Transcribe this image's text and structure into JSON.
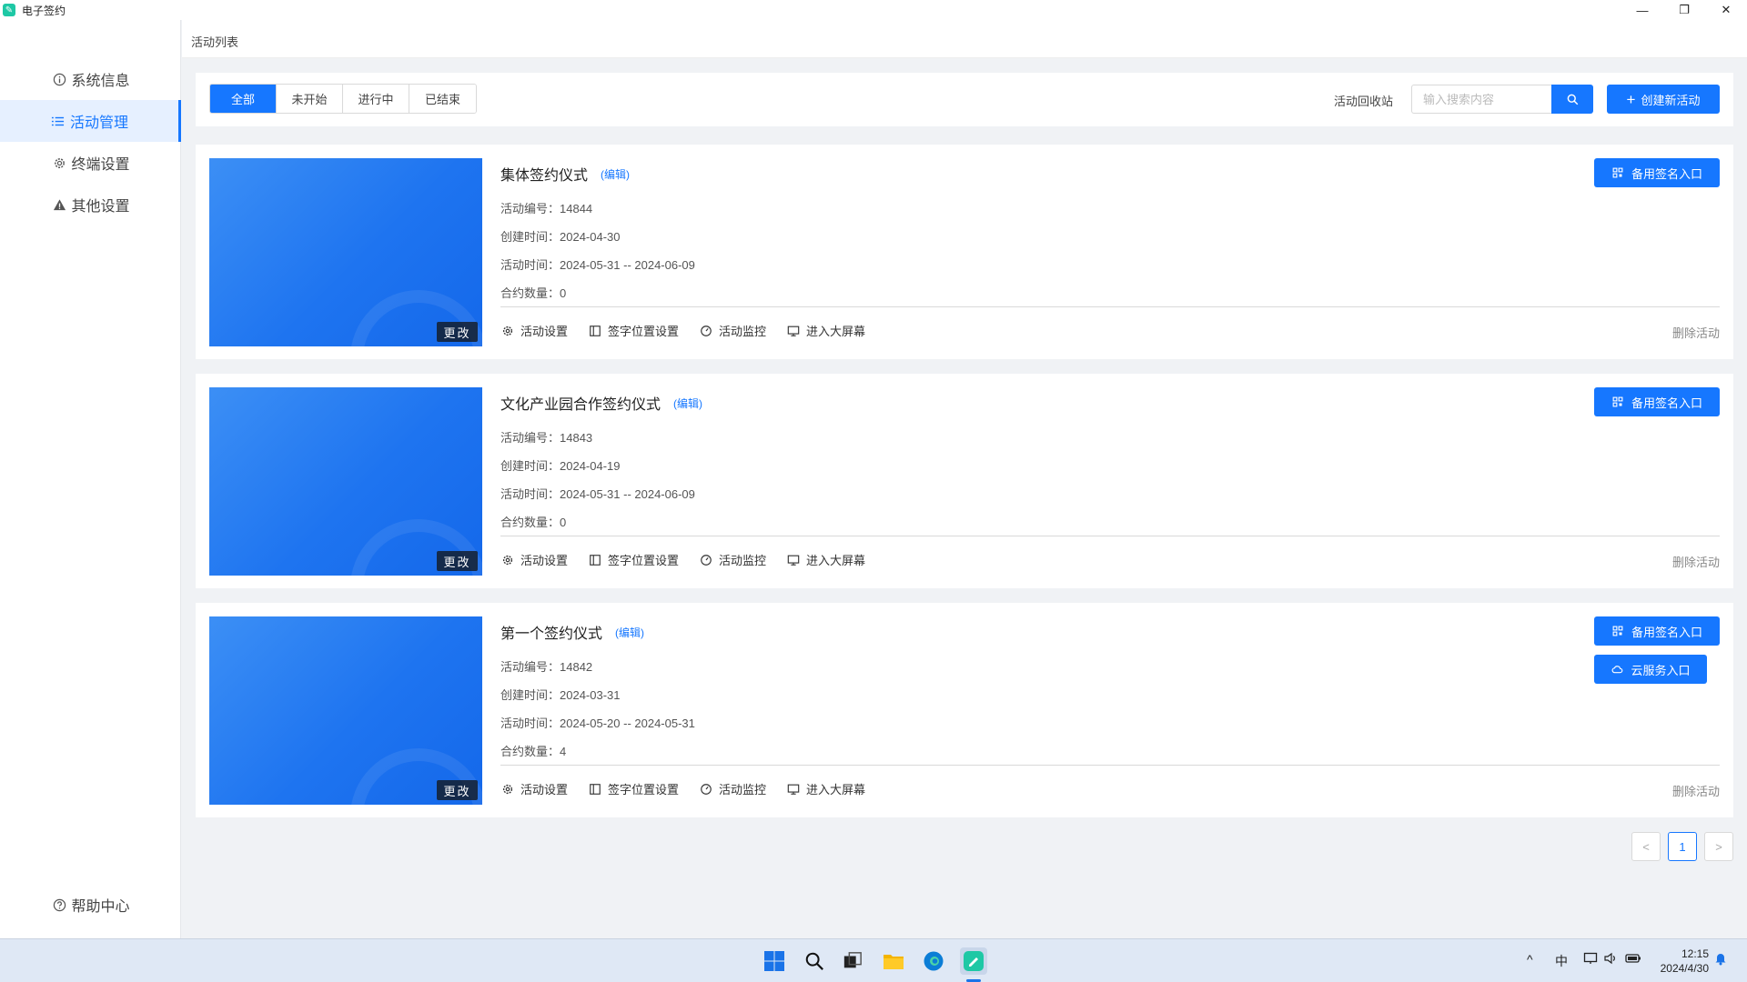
{
  "window": {
    "title": "电子签约",
    "app_icon_glyph": "✎",
    "controls": [
      "—",
      "❐",
      "✕"
    ]
  },
  "sidebar": {
    "items": [
      {
        "label": "系统信息",
        "icon": "info-circle-icon"
      },
      {
        "label": "活动管理",
        "icon": "list-icon",
        "active": true
      },
      {
        "label": "终端设置",
        "icon": "gear-icon"
      },
      {
        "label": "其他设置",
        "icon": "warning-triangle-icon"
      }
    ],
    "help": {
      "label": "帮助中心",
      "icon": "question-circle-icon"
    }
  },
  "breadcrumb": {
    "label": "活动列表"
  },
  "toolbar": {
    "tabs": [
      "全部",
      "未开始",
      "进行中",
      "已结束"
    ],
    "active_tab": "全部",
    "recycle_label": "活动回收站",
    "search_placeholder": "输入搜索内容",
    "search_value": "",
    "create_label": "创建新活动"
  },
  "activities": [
    {
      "title": "集体签约仪式",
      "edit_label": "(编辑)",
      "id_label": "活动编号：14844",
      "created_label": "创建时间：2024-04-30",
      "period_label": "活动时间：2024-05-31 -- 2024-06-09",
      "count_label": "合约数量：0",
      "change_label": "更改",
      "buttons": [
        "备用签名入口"
      ]
    },
    {
      "title": "文化产业园合作签约仪式",
      "edit_label": "(编辑)",
      "id_label": "活动编号：14843",
      "created_label": "创建时间：2024-04-19",
      "period_label": "活动时间：2024-05-31 -- 2024-06-09",
      "count_label": "合约数量：0",
      "change_label": "更改",
      "buttons": [
        "备用签名入口"
      ]
    },
    {
      "title": "第一个签约仪式",
      "edit_label": "(编辑)",
      "id_label": "活动编号：14842",
      "created_label": "创建时间：2024-03-31",
      "period_label": "活动时间：2024-05-20 -- 2024-05-31",
      "count_label": "合约数量：4",
      "change_label": "更改",
      "buttons": [
        "备用签名入口",
        "云服务入口"
      ]
    }
  ],
  "card_actions": [
    "活动设置",
    "签字位置设置",
    "活动监控",
    "进入大屏幕"
  ],
  "delete_label": "删除活动",
  "pagination": {
    "prev": "<",
    "current": "1",
    "next": ">"
  },
  "taskbar": {
    "tray_chevron": "^",
    "ime_label": "中",
    "time": "12:15",
    "date": "2024/4/30"
  },
  "colors": {
    "primary": "#1677ff",
    "active_bg": "#e6f0ff",
    "app_icon": "#1ec8a5"
  }
}
